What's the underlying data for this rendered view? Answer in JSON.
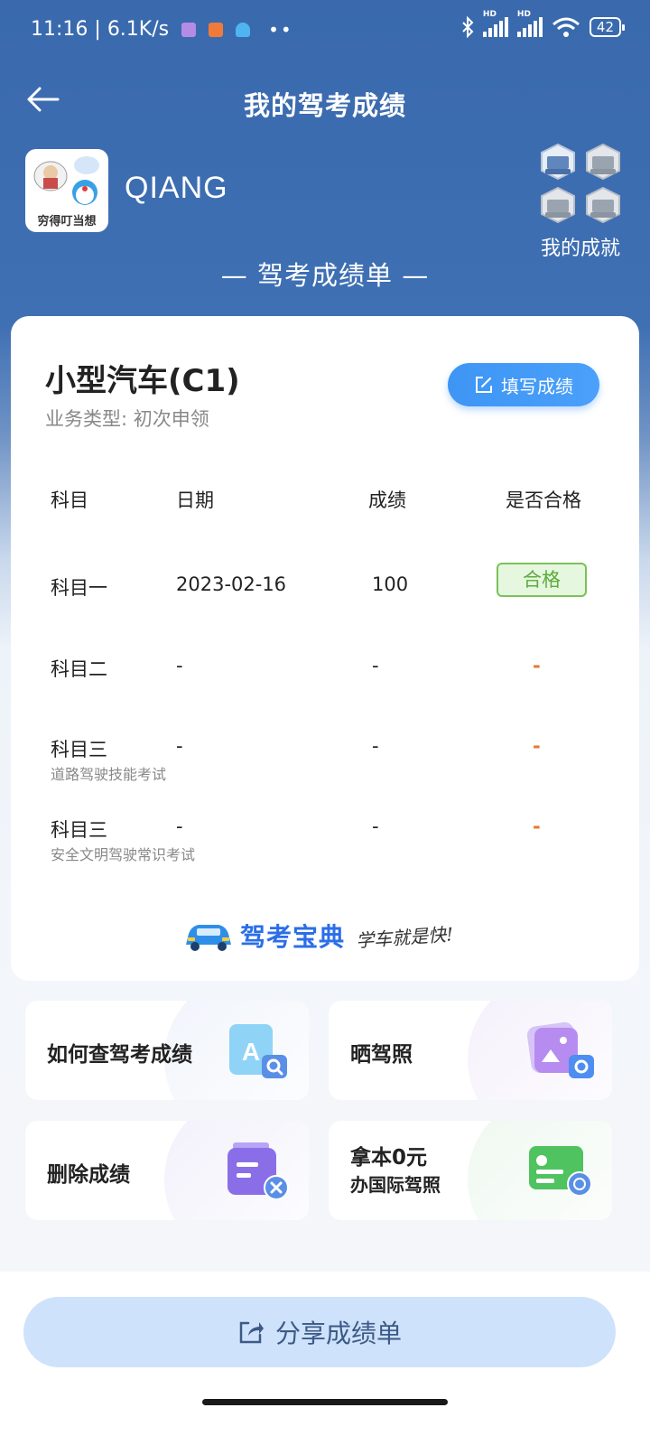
{
  "status_bar": {
    "time": "11:16",
    "network_speed": "6.1K/s",
    "signal_label_1": "HD",
    "signal_label_2": "HD",
    "battery": "42"
  },
  "header": {
    "title": "我的驾考成绩"
  },
  "profile": {
    "avatar_caption": "穷得叮当想",
    "username": "QIANG",
    "achievements_label": "我的成就"
  },
  "sheet_title": "— 驾考成绩单 —",
  "card": {
    "vehicle": "小型汽车(C1)",
    "business_type": "业务类型: 初次申领",
    "fill_button": "填写成绩",
    "columns": [
      "科目",
      "日期",
      "成绩",
      "是否合格"
    ],
    "rows": [
      {
        "subject": "科目一",
        "note": "",
        "date": "2023-02-16",
        "score": "100",
        "pass": "合格"
      },
      {
        "subject": "科目二",
        "note": "",
        "date": "-",
        "score": "-",
        "pass": "-"
      },
      {
        "subject": "科目三",
        "note": "道路驾驶技能考试",
        "date": "-",
        "score": "-",
        "pass": "-"
      },
      {
        "subject": "科目三",
        "note": "安全文明驾驶常识考试",
        "date": "-",
        "score": "-",
        "pass": "-"
      }
    ],
    "brand_name": "驾考宝典",
    "brand_slogan": "学车就是快!"
  },
  "tiles": [
    {
      "label": "如何查驾考成绩"
    },
    {
      "label": "晒驾照"
    },
    {
      "label": "删除成绩"
    },
    {
      "label": "拿本0元",
      "sub": "办国际驾照"
    }
  ],
  "share_button": "分享成绩单",
  "colors": {
    "header_blue": "#3a69ad",
    "accent_blue": "#3e95f4",
    "pass_green": "#5cab3b",
    "dash_orange": "#e87830"
  }
}
